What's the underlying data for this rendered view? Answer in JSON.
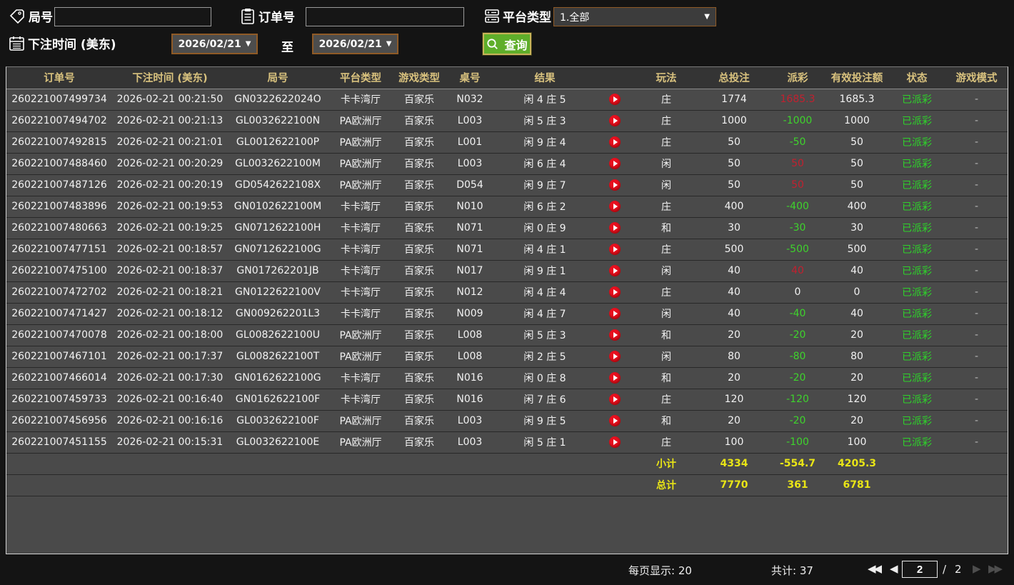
{
  "filters": {
    "game_no_label": "局号",
    "game_no_value": "",
    "order_no_label": "订单号",
    "order_no_value": "",
    "platform_label": "平台类型",
    "platform_value": "1.全部",
    "bet_time_label": "下注时间 (美东)",
    "date_from": "2026/02/21",
    "to_label": "至",
    "date_to": "2026/02/21",
    "query_label": "查询"
  },
  "table": {
    "headers": [
      "订单号",
      "下注时间 (美东)",
      "局号",
      "平台类型",
      "游戏类型",
      "桌号",
      "结果",
      "",
      "玩法",
      "总投注",
      "派彩",
      "有效投注额",
      "状态",
      "游戏模式"
    ],
    "rows": [
      {
        "order": "260221007499734",
        "time": "2026-02-21 00:21:50",
        "round": "GN0322622024O",
        "platform": "卡卡湾厅",
        "game": "百家乐",
        "table": "N032",
        "result": "闲 4 庄 5",
        "bet_on": "庄",
        "total_bet": "1774",
        "payout": "1685.3",
        "valid_bet": "1685.3",
        "status": "已派彩",
        "mode": "-"
      },
      {
        "order": "260221007494702",
        "time": "2026-02-21 00:21:13",
        "round": "GL0032622100N",
        "platform": "PA欧洲厅",
        "game": "百家乐",
        "table": "L003",
        "result": "闲 5 庄 3",
        "bet_on": "庄",
        "total_bet": "1000",
        "payout": "-1000",
        "valid_bet": "1000",
        "status": "已派彩",
        "mode": "-"
      },
      {
        "order": "260221007492815",
        "time": "2026-02-21 00:21:01",
        "round": "GL0012622100P",
        "platform": "PA欧洲厅",
        "game": "百家乐",
        "table": "L001",
        "result": "闲 9 庄 4",
        "bet_on": "庄",
        "total_bet": "50",
        "payout": "-50",
        "valid_bet": "50",
        "status": "已派彩",
        "mode": "-"
      },
      {
        "order": "260221007488460",
        "time": "2026-02-21 00:20:29",
        "round": "GL0032622100M",
        "platform": "PA欧洲厅",
        "game": "百家乐",
        "table": "L003",
        "result": "闲 6 庄 4",
        "bet_on": "闲",
        "total_bet": "50",
        "payout": "50",
        "valid_bet": "50",
        "status": "已派彩",
        "mode": "-"
      },
      {
        "order": "260221007487126",
        "time": "2026-02-21 00:20:19",
        "round": "GD0542622108X",
        "platform": "PA欧洲厅",
        "game": "百家乐",
        "table": "D054",
        "result": "闲 9 庄 7",
        "bet_on": "闲",
        "total_bet": "50",
        "payout": "50",
        "valid_bet": "50",
        "status": "已派彩",
        "mode": "-"
      },
      {
        "order": "260221007483896",
        "time": "2026-02-21 00:19:53",
        "round": "GN0102622100M",
        "platform": "卡卡湾厅",
        "game": "百家乐",
        "table": "N010",
        "result": "闲 6 庄 2",
        "bet_on": "庄",
        "total_bet": "400",
        "payout": "-400",
        "valid_bet": "400",
        "status": "已派彩",
        "mode": "-"
      },
      {
        "order": "260221007480663",
        "time": "2026-02-21 00:19:25",
        "round": "GN0712622100H",
        "platform": "卡卡湾厅",
        "game": "百家乐",
        "table": "N071",
        "result": "闲 0 庄 9",
        "bet_on": "和",
        "total_bet": "30",
        "payout": "-30",
        "valid_bet": "30",
        "status": "已派彩",
        "mode": "-"
      },
      {
        "order": "260221007477151",
        "time": "2026-02-21 00:18:57",
        "round": "GN0712622100G",
        "platform": "卡卡湾厅",
        "game": "百家乐",
        "table": "N071",
        "result": "闲 4 庄 1",
        "bet_on": "庄",
        "total_bet": "500",
        "payout": "-500",
        "valid_bet": "500",
        "status": "已派彩",
        "mode": "-"
      },
      {
        "order": "260221007475100",
        "time": "2026-02-21 00:18:37",
        "round": "GN017262201JB",
        "platform": "卡卡湾厅",
        "game": "百家乐",
        "table": "N017",
        "result": "闲 9 庄 1",
        "bet_on": "闲",
        "total_bet": "40",
        "payout": "40",
        "valid_bet": "40",
        "status": "已派彩",
        "mode": "-"
      },
      {
        "order": "260221007472702",
        "time": "2026-02-21 00:18:21",
        "round": "GN0122622100V",
        "platform": "卡卡湾厅",
        "game": "百家乐",
        "table": "N012",
        "result": "闲 4 庄 4",
        "bet_on": "庄",
        "total_bet": "40",
        "payout": "0",
        "valid_bet": "0",
        "status": "已派彩",
        "mode": "-"
      },
      {
        "order": "260221007471427",
        "time": "2026-02-21 00:18:12",
        "round": "GN009262201L3",
        "platform": "卡卡湾厅",
        "game": "百家乐",
        "table": "N009",
        "result": "闲 4 庄 7",
        "bet_on": "闲",
        "total_bet": "40",
        "payout": "-40",
        "valid_bet": "40",
        "status": "已派彩",
        "mode": "-"
      },
      {
        "order": "260221007470078",
        "time": "2026-02-21 00:18:00",
        "round": "GL0082622100U",
        "platform": "PA欧洲厅",
        "game": "百家乐",
        "table": "L008",
        "result": "闲 5 庄 3",
        "bet_on": "和",
        "total_bet": "20",
        "payout": "-20",
        "valid_bet": "20",
        "status": "已派彩",
        "mode": "-"
      },
      {
        "order": "260221007467101",
        "time": "2026-02-21 00:17:37",
        "round": "GL0082622100T",
        "platform": "PA欧洲厅",
        "game": "百家乐",
        "table": "L008",
        "result": "闲 2 庄 5",
        "bet_on": "闲",
        "total_bet": "80",
        "payout": "-80",
        "valid_bet": "80",
        "status": "已派彩",
        "mode": "-"
      },
      {
        "order": "260221007466014",
        "time": "2026-02-21 00:17:30",
        "round": "GN0162622100G",
        "platform": "卡卡湾厅",
        "game": "百家乐",
        "table": "N016",
        "result": "闲 0 庄 8",
        "bet_on": "和",
        "total_bet": "20",
        "payout": "-20",
        "valid_bet": "20",
        "status": "已派彩",
        "mode": "-"
      },
      {
        "order": "260221007459733",
        "time": "2026-02-21 00:16:40",
        "round": "GN0162622100F",
        "platform": "卡卡湾厅",
        "game": "百家乐",
        "table": "N016",
        "result": "闲 7 庄 6",
        "bet_on": "庄",
        "total_bet": "120",
        "payout": "-120",
        "valid_bet": "120",
        "status": "已派彩",
        "mode": "-"
      },
      {
        "order": "260221007456956",
        "time": "2026-02-21 00:16:16",
        "round": "GL0032622100F",
        "platform": "PA欧洲厅",
        "game": "百家乐",
        "table": "L003",
        "result": "闲 9 庄 5",
        "bet_on": "和",
        "total_bet": "20",
        "payout": "-20",
        "valid_bet": "20",
        "status": "已派彩",
        "mode": "-"
      },
      {
        "order": "260221007451155",
        "time": "2026-02-21 00:15:31",
        "round": "GL0032622100E",
        "platform": "PA欧洲厅",
        "game": "百家乐",
        "table": "L003",
        "result": "闲 5 庄 1",
        "bet_on": "庄",
        "total_bet": "100",
        "payout": "-100",
        "valid_bet": "100",
        "status": "已派彩",
        "mode": "-"
      }
    ],
    "subtotal": {
      "label": "小计",
      "total_bet": "4334",
      "payout": "-554.7",
      "valid_bet": "4205.3"
    },
    "grand_total": {
      "label": "总计",
      "total_bet": "7770",
      "payout": "361",
      "valid_bet": "6781"
    }
  },
  "pagination": {
    "per_page_label": "每页显示: 20",
    "total_count_label": "共计: 37",
    "current_page": "2",
    "separator": "/",
    "total_pages": "2"
  },
  "colors": {
    "payout_win": "#c2202f",
    "payout_loss": "#3ed32c",
    "payout_zero": "#f2f2f2",
    "status_settled": "#2ed32a",
    "totals_yellow": "#e9e516",
    "header_gold": "#d9c27e",
    "query_button_green": "#5fae2a",
    "date_border_brown": "#8f5a26",
    "play_red": "#e8101f"
  }
}
